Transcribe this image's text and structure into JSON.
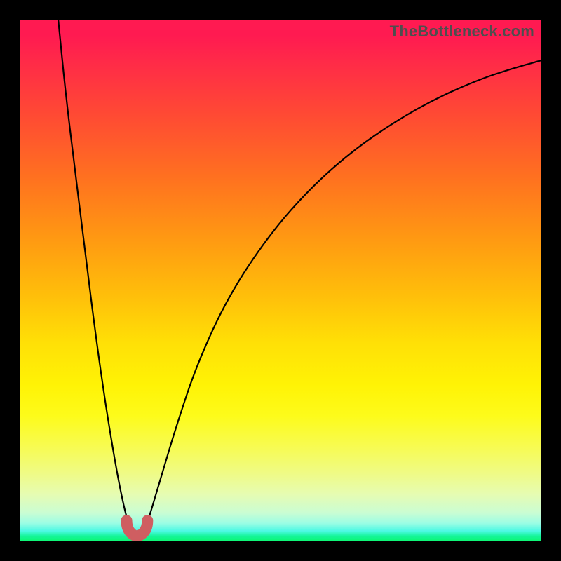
{
  "attribution": "TheBottleneck.com",
  "colors": {
    "page_bg": "#000000",
    "gradient_top": "#ff1a51",
    "gradient_mid": "#ffe006",
    "gradient_bottom": "#0cf66f",
    "curve_stroke": "#000000",
    "marker_stroke": "#cf5e61"
  },
  "chart_data": {
    "type": "line",
    "title": "",
    "xlabel": "",
    "ylabel": "",
    "xlim": [
      0,
      1
    ],
    "ylim": [
      0,
      1
    ],
    "series": [
      {
        "name": "left_branch",
        "x": [
          0.074,
          0.088,
          0.105,
          0.125,
          0.145,
          0.165,
          0.185,
          0.2,
          0.21,
          0.216
        ],
        "y": [
          1.0,
          0.86,
          0.72,
          0.56,
          0.4,
          0.26,
          0.14,
          0.065,
          0.03,
          0.013
        ]
      },
      {
        "name": "right_branch",
        "x": [
          0.236,
          0.248,
          0.27,
          0.3,
          0.34,
          0.4,
          0.48,
          0.56,
          0.64,
          0.72,
          0.8,
          0.88,
          0.94,
          1.0
        ],
        "y": [
          0.013,
          0.045,
          0.12,
          0.22,
          0.34,
          0.47,
          0.59,
          0.68,
          0.75,
          0.805,
          0.85,
          0.885,
          0.905,
          0.922
        ]
      }
    ],
    "marker": {
      "name": "trough-marker",
      "x_range": [
        0.205,
        0.245
      ],
      "y_range": [
        0.01,
        0.04
      ]
    }
  }
}
